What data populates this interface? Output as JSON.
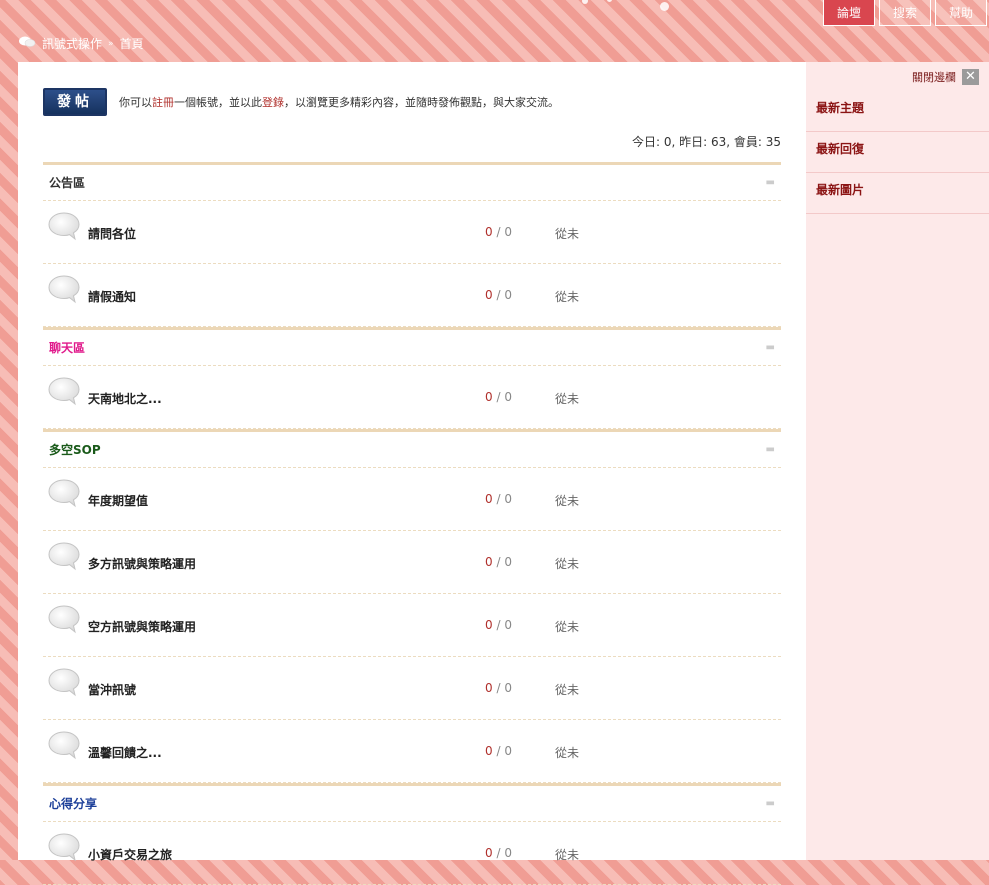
{
  "nav": {
    "tabs": [
      {
        "label": "論壇",
        "active": true
      },
      {
        "label": "搜索",
        "active": false
      },
      {
        "label": "幫助",
        "active": false
      }
    ]
  },
  "breadcrumb": {
    "icon": "chat-bubble-icon",
    "site": "訊號式操作",
    "current": "首頁"
  },
  "post_button": "發帖",
  "intro": {
    "p1": "你可以",
    "register": "註冊",
    "p2": "一個帳號，並以此",
    "login": "登錄",
    "p3": "，以瀏覽更多精彩內容，並隨時發佈觀點，與大家交流。"
  },
  "stats": "今日: 0, 昨日: 63, 會員: 35",
  "categories": [
    {
      "title": "公告區",
      "color": "#333333",
      "forums": [
        {
          "name": "請問各位",
          "topics": "0",
          "posts": "0",
          "last": "從未"
        },
        {
          "name": "請假通知",
          "topics": "0",
          "posts": "0",
          "last": "從未"
        }
      ]
    },
    {
      "title": "聊天區",
      "color": "#e0198b",
      "forums": [
        {
          "name": "天南地北之...",
          "topics": "0",
          "posts": "0",
          "last": "從未"
        }
      ]
    },
    {
      "title": "多空SOP",
      "color": "#1a5a1a",
      "forums": [
        {
          "name": "年度期望值",
          "topics": "0",
          "posts": "0",
          "last": "從未"
        },
        {
          "name": "多方訊號與策略運用",
          "topics": "0",
          "posts": "0",
          "last": "從未"
        },
        {
          "name": "空方訊號與策略運用",
          "topics": "0",
          "posts": "0",
          "last": "從未"
        },
        {
          "name": "當沖訊號",
          "topics": "0",
          "posts": "0",
          "last": "從未"
        },
        {
          "name": "溫馨回饋之...",
          "topics": "0",
          "posts": "0",
          "last": "從未"
        }
      ]
    },
    {
      "title": "心得分享",
      "color": "#1c3f99",
      "forums": [
        {
          "name": "小資戶交易之旅",
          "topics": "0",
          "posts": "0",
          "last": "從未"
        }
      ]
    }
  ],
  "sidebar": {
    "close_label": "關閉邊欄",
    "close_icon": "close-icon",
    "items": [
      "最新主題",
      "最新回復",
      "最新圖片"
    ]
  }
}
